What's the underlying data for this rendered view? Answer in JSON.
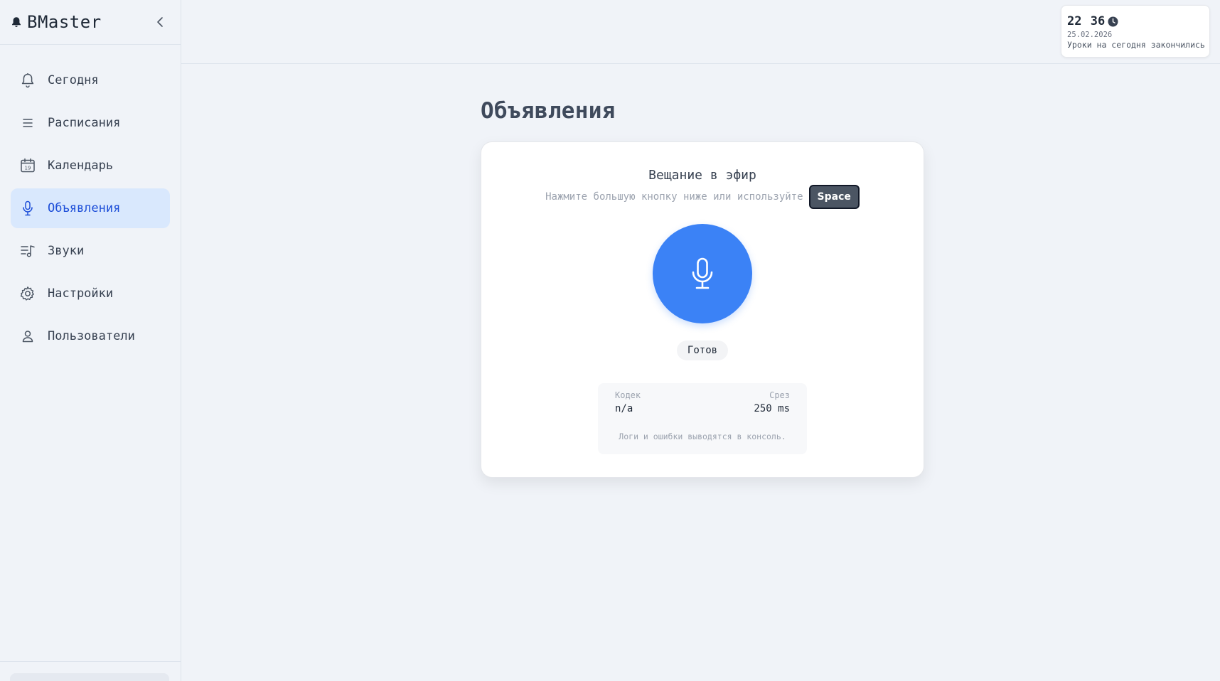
{
  "sidebar": {
    "brand": "BMaster",
    "items": [
      {
        "label": "Сегодня",
        "icon": "bell-icon"
      },
      {
        "label": "Расписания",
        "icon": "list-icon"
      },
      {
        "label": "Календарь",
        "icon": "calendar-icon"
      },
      {
        "label": "Объявления",
        "icon": "microphone-icon",
        "active": true
      },
      {
        "label": "Звуки",
        "icon": "playlist-music-icon"
      },
      {
        "label": "Настройки",
        "icon": "gear-icon"
      },
      {
        "label": "Пользователи",
        "icon": "user-icon"
      }
    ],
    "calendar_icon_day": "19"
  },
  "topbar": {
    "clock": {
      "time": "22 36",
      "date": "25.02.2026",
      "status": "Уроки на сегодня закончились"
    }
  },
  "main": {
    "title": "Объявления",
    "broadcast": {
      "title": "Вещание в эфир",
      "hint": "Нажмите большую кнопку ниже или используйте",
      "key": "Space",
      "status": "Готов",
      "codec_label": "Кодек",
      "codec_value": "n/a",
      "slice_label": "Срез",
      "slice_value": "250 ms",
      "note": "Логи и ошибки выводятся в консоль."
    }
  },
  "colors": {
    "accent": "#3b82f6",
    "active_nav_bg": "#d9e8fd",
    "active_nav_text": "#1d4ed8",
    "background": "#f0f3f8"
  }
}
